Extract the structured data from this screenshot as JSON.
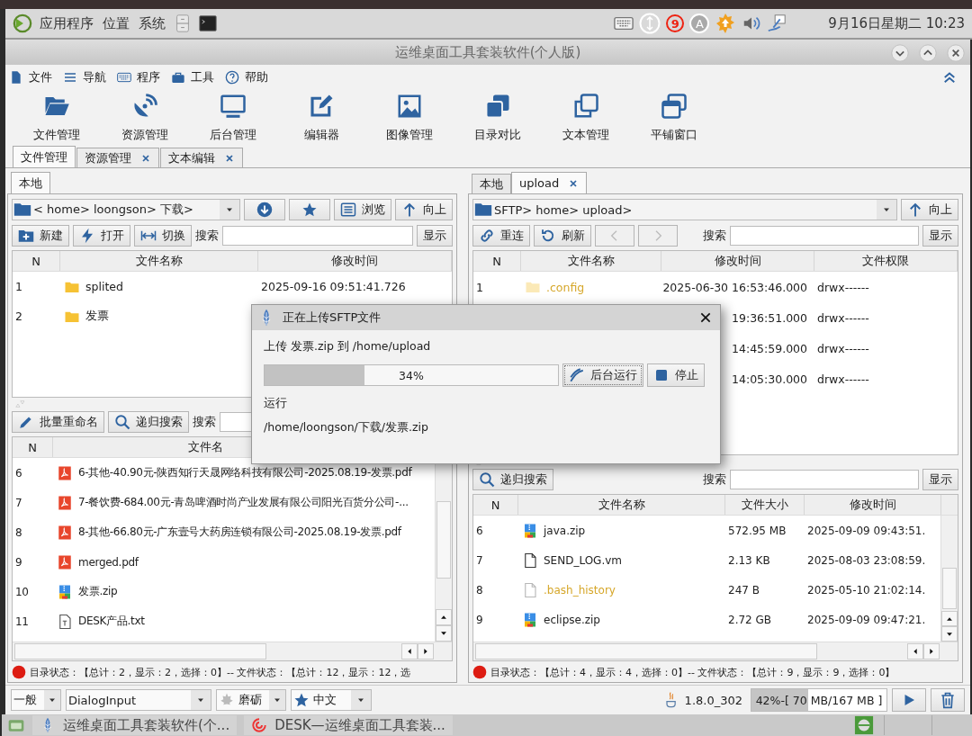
{
  "top_panel": {
    "menus": [
      "应用程序",
      "位置",
      "系统"
    ],
    "tray_badge": "9",
    "input_method": "A",
    "clock": "9月16日星期二 10:23"
  },
  "window": {
    "title": "运维桌面工具套装软件(个人版)"
  },
  "menu_bar": [
    "文件",
    "导航",
    "程序",
    "工具",
    "帮助"
  ],
  "toolbar": [
    "文件管理",
    "资源管理",
    "后台管理",
    "编辑器",
    "图像管理",
    "目录对比",
    "文本管理",
    "平铺窗口"
  ],
  "tabs": [
    {
      "label": "文件管理",
      "selected": true,
      "closable": false
    },
    {
      "label": "资源管理",
      "selected": false,
      "closable": true
    },
    {
      "label": "文本编辑",
      "selected": false,
      "closable": true
    }
  ],
  "local_pane": {
    "tabs": [
      {
        "label": "本地",
        "selected": true,
        "closable": false
      }
    ],
    "path": "< home> loongson> 下载>",
    "path_buttons": [
      "浏览",
      "向上"
    ],
    "actions": [
      "新建",
      "打开",
      "切换"
    ],
    "search_label": "搜索",
    "show_button": "显示",
    "dir_columns": [
      "N",
      "文件名称",
      "修改时间"
    ],
    "dirs": [
      {
        "n": "1",
        "name": "splited",
        "kind": "folder",
        "hidden": false,
        "time": "2025-09-16 09:51:41.726"
      },
      {
        "n": "2",
        "name": "发票",
        "kind": "folder",
        "hidden": false
      }
    ],
    "file_actions": [
      "批量重命名",
      "递归搜索"
    ],
    "file_search_label": "搜索",
    "file_columns": [
      "N",
      "文件名"
    ],
    "files": [
      {
        "n": "6",
        "name": "6-其他-40.90元-陕西知行天晟网络科技有限公司-2025.08.19-发票.pdf",
        "kind": "pdf"
      },
      {
        "n": "7",
        "name": "7-餐饮费-684.00元-青岛啤酒时尚产业发展有限公司阳光百货分公司-...",
        "kind": "pdf"
      },
      {
        "n": "8",
        "name": "8-其他-66.80元-广东壹号大药房连锁有限公司-2025.08.19-发票.pdf",
        "kind": "pdf"
      },
      {
        "n": "9",
        "name": "merged.pdf",
        "kind": "pdf"
      },
      {
        "n": "10",
        "name": "发票.zip",
        "kind": "zip"
      },
      {
        "n": "11",
        "name": "DESK产品.txt",
        "kind": "txt"
      }
    ],
    "status": "目录状态：【总计：2，显示：2，选择：0】-- 文件状态：【总计：12，显示：12，选"
  },
  "remote_pane": {
    "tabs": [
      {
        "label": "本地",
        "selected": false,
        "closable": false
      },
      {
        "label": "upload",
        "selected": true,
        "closable": true
      }
    ],
    "path": "SFTP> home> upload>",
    "path_button": "向上",
    "actions": [
      "重连",
      "刷新"
    ],
    "search_label": "搜索",
    "show_button": "显示",
    "dir_columns": [
      "N",
      "文件名称",
      "修改时间",
      "文件权限"
    ],
    "dirs": [
      {
        "n": "1",
        "name": ".config",
        "kind": "folder",
        "hidden": true,
        "time": "2025-06-30 16:53:46.000",
        "perm": "drwx------"
      },
      {
        "time": "19:36:51.000",
        "perm": "drwx------"
      },
      {
        "time": "14:45:59.000",
        "perm": "drwx------"
      },
      {
        "time": "14:05:30.000",
        "perm": "drwx------"
      }
    ],
    "file_action": "递归搜索",
    "file_search_label": "搜索",
    "file_show_button": "显示",
    "file_columns": [
      "N",
      "文件名称",
      "文件大小",
      "修改时间"
    ],
    "files": [
      {
        "n": "6",
        "name": "java.zip",
        "kind": "zip",
        "hidden": false,
        "size": "572.95 MB",
        "time": "2025-09-09 09:43:51."
      },
      {
        "n": "7",
        "name": "SEND_LOG.vm",
        "kind": "file",
        "hidden": false,
        "size": "2.13 KB",
        "time": "2025-08-03 23:08:59."
      },
      {
        "n": "8",
        "name": ".bash_history",
        "kind": "file",
        "hidden": true,
        "size": "247 B",
        "time": "2025-05-10 21:02:14."
      },
      {
        "n": "9",
        "name": "eclipse.zip",
        "kind": "zip",
        "hidden": false,
        "size": "2.72 GB",
        "time": "2025-09-09 09:47:21."
      }
    ],
    "status": "目录状态：【总计：4，显示：4，选择：0】-- 文件状态：【总计：9，显示：9，选择：0】"
  },
  "dialog": {
    "title": "正在上传SFTP文件",
    "message": "上传 发票.zip 到 /home/upload",
    "progress": {
      "level": 0.34,
      "label": "34%"
    },
    "buttons": [
      "后台运行",
      "停止"
    ],
    "state": "运行",
    "path": "/home/loongson/下载/发票.zip"
  },
  "bottom_bar": {
    "combos": [
      "一般",
      "DialogInput",
      "磨砺",
      "中文"
    ],
    "java_version": "1.8.0_302",
    "memory": {
      "level": 0.42,
      "label": "42%-[ 70 MB/167 MB ]"
    }
  },
  "taskbar": {
    "tasks": [
      "运维桌面工具套装软件(个...",
      "DESK—运维桌面工具套装..."
    ]
  }
}
